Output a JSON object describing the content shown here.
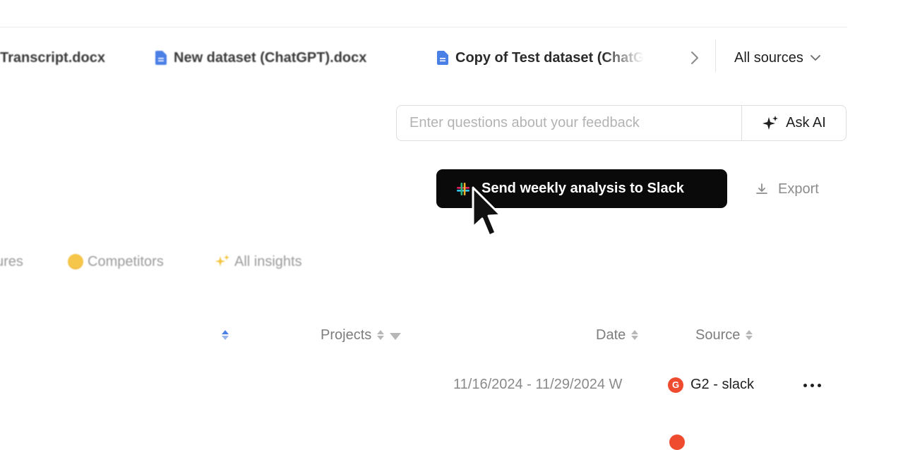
{
  "files": [
    {
      "name": "Transcript.docx",
      "icon": "doc-icon"
    },
    {
      "name": "New dataset (ChatGPT).docx",
      "icon": "doc-icon"
    },
    {
      "name": "Copy of Test dataset (ChatG",
      "icon": "doc-icon"
    }
  ],
  "sources_dropdown": {
    "label": "All sources"
  },
  "ask": {
    "placeholder": "Enter questions about your feedback",
    "button_label": "Ask AI"
  },
  "actions": {
    "slack_label": "Send weekly analysis to Slack",
    "export_label": "Export"
  },
  "tabs": [
    {
      "label": "ures"
    },
    {
      "label": "Competitors"
    },
    {
      "label": "All insights"
    }
  ],
  "table": {
    "headers": {
      "projects": "Projects",
      "date": "Date",
      "source": "Source"
    },
    "rows": [
      {
        "date": "11/16/2024 - 11/29/2024 W",
        "source": "G2 - slack",
        "source_icon": "G"
      }
    ]
  },
  "colors": {
    "accent": "#4a7fe6",
    "doc_blue": "#4a7fe6",
    "g2_red": "#ef4b2f",
    "dark_button": "#0a0a0a"
  }
}
